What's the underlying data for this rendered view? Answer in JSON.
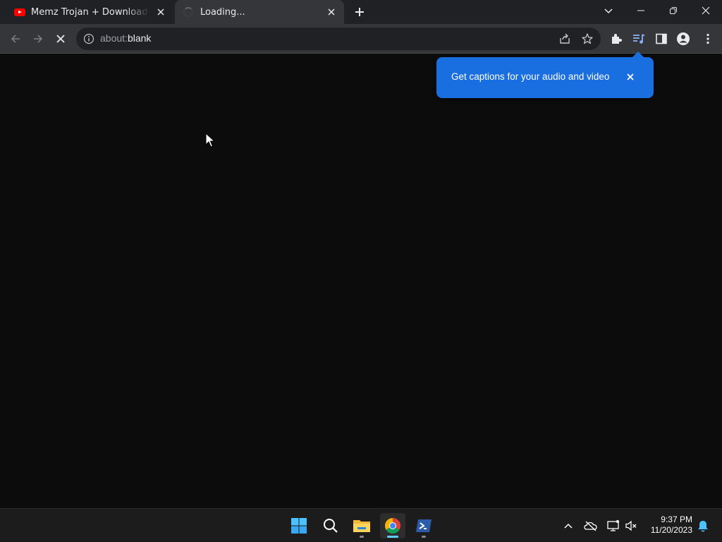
{
  "browser": {
    "tabs": [
      {
        "title": "Memz Trojan + Download Link - YouTube",
        "icon": "youtube-icon",
        "active": false
      },
      {
        "title": "Loading...",
        "icon": "loading-spinner-icon",
        "active": true
      }
    ],
    "address_bar": {
      "scheme": "about:",
      "host": "blank"
    },
    "caption_bubble": {
      "text": "Get captions for your audio and video"
    }
  },
  "taskbar": {
    "clock": {
      "time": "9:37 PM",
      "date": "11/20/2023"
    },
    "apps": [
      "start-icon",
      "search-icon",
      "file-explorer-icon",
      "chrome-icon",
      "powershell-icon"
    ]
  },
  "colors": {
    "accent": "#1a6fe0",
    "tabstrip": "#202124",
    "toolbar": "#35363a",
    "content": "#0c0c0d",
    "taskbar": "#1c1c1c"
  }
}
